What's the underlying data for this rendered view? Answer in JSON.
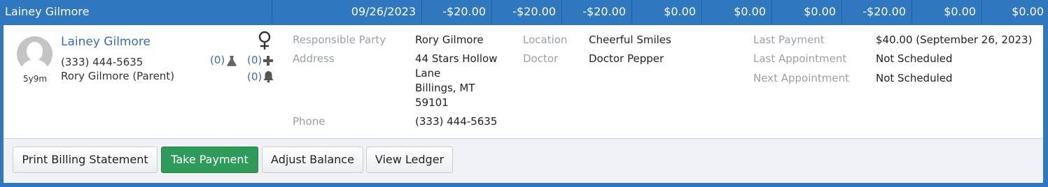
{
  "header": {
    "patient_name": "Lainey Gilmore",
    "date": "09/26/2023",
    "balances": [
      "-$20.00",
      "-$20.00",
      "-$20.00",
      "$0.00",
      "$0.00",
      "$0.00",
      "-$20.00",
      "$0.00",
      "$0.00"
    ]
  },
  "patient": {
    "name": "Lainey Gilmore",
    "phone": "(333) 444-5635",
    "guardian": "Rory Gilmore (Parent)",
    "age": "5y9m",
    "gender_icon": "female-icon",
    "lab_count": "(0)",
    "medical_count": "(0)",
    "alert_count": "(0)"
  },
  "details": {
    "responsible_party_label": "Responsible Party",
    "responsible_party": "Rory Gilmore",
    "address_label": "Address",
    "address_line1": "44 Stars Hollow",
    "address_line2": "Lane",
    "address_line3": "Billings, MT",
    "address_line4": "59101",
    "phone_label": "Phone",
    "phone": "(333) 444-5635",
    "location_label": "Location",
    "location": "Cheerful Smiles",
    "doctor_label": "Doctor",
    "doctor": "Doctor Pepper",
    "last_payment_label": "Last Payment",
    "last_payment": "$40.00 (September 26, 2023)",
    "last_appointment_label": "Last Appointment",
    "last_appointment": "Not Scheduled",
    "next_appointment_label": "Next Appointment",
    "next_appointment": "Not Scheduled"
  },
  "actions": {
    "print_billing": "Print Billing Statement",
    "take_payment": "Take Payment",
    "adjust_balance": "Adjust Balance",
    "view_ledger": "View Ledger"
  },
  "colors": {
    "header_blue": "#2f78c0",
    "link_blue": "#3a6da8",
    "primary_green": "#2f9b5a",
    "label_gray": "#9aa0a6"
  }
}
